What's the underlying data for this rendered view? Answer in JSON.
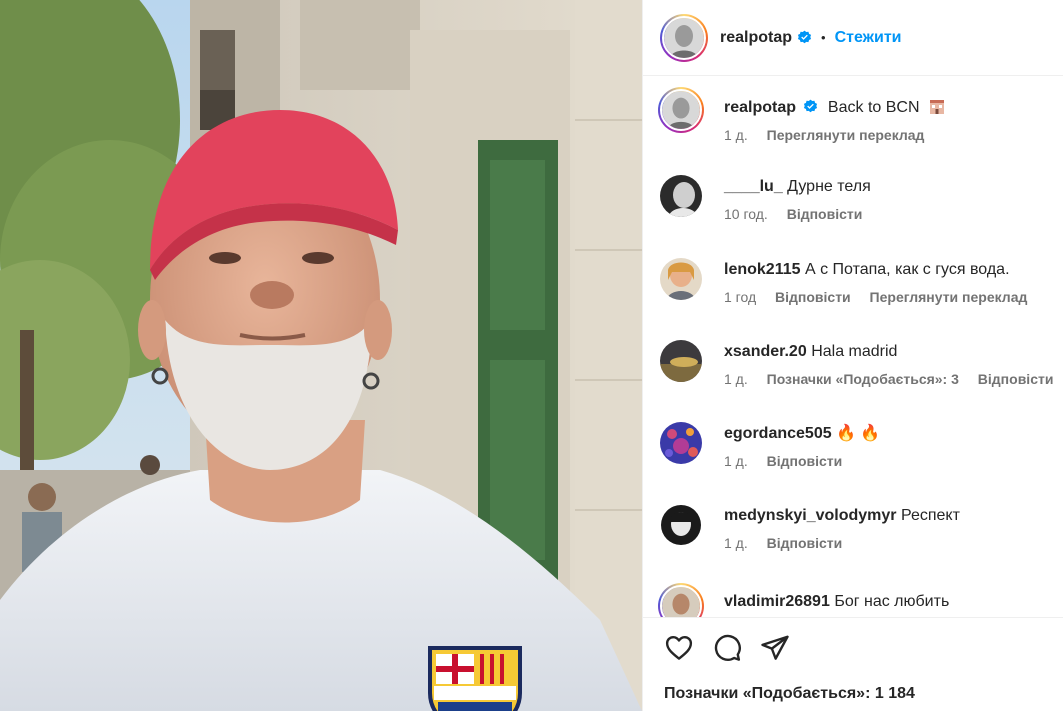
{
  "post": {
    "author": "realpotap",
    "follow_label": "Стежити",
    "caption_text": "Back to BCN",
    "caption_time": "1 д.",
    "caption_translate": "Переглянути переклад"
  },
  "comments": [
    {
      "user": "____lu_",
      "text": "Дурне теля",
      "time": "10 год.",
      "reply": "Відповісти"
    },
    {
      "user": "lenok2115",
      "text": "А с Потапа, как с гуся вода.",
      "time": "1 год",
      "reply": "Відповісти",
      "translate": "Переглянути переклад"
    },
    {
      "user": "xsander.20",
      "text": "Hala madrid",
      "time": "1 д.",
      "likes": "Позначки «Подобається»: 3",
      "reply": "Відповісти"
    },
    {
      "user": "egordance505",
      "text": "🔥 🔥",
      "time": "1 д.",
      "reply": "Відповісти"
    },
    {
      "user": "medynskyi_volodymyr",
      "text": "Респект",
      "time": "1 д.",
      "reply": "Відповісти"
    },
    {
      "user": "vladimir26891",
      "text": "Бог нас любить"
    }
  ],
  "footer": {
    "likes_text": "Позначки «Подобається»: 1 184"
  },
  "icons": [
    "heart-icon",
    "comment-icon",
    "share-icon",
    "verified-badge-icon"
  ],
  "colors": {
    "accent": "#0095f6",
    "text": "#262626",
    "muted": "#737373"
  }
}
